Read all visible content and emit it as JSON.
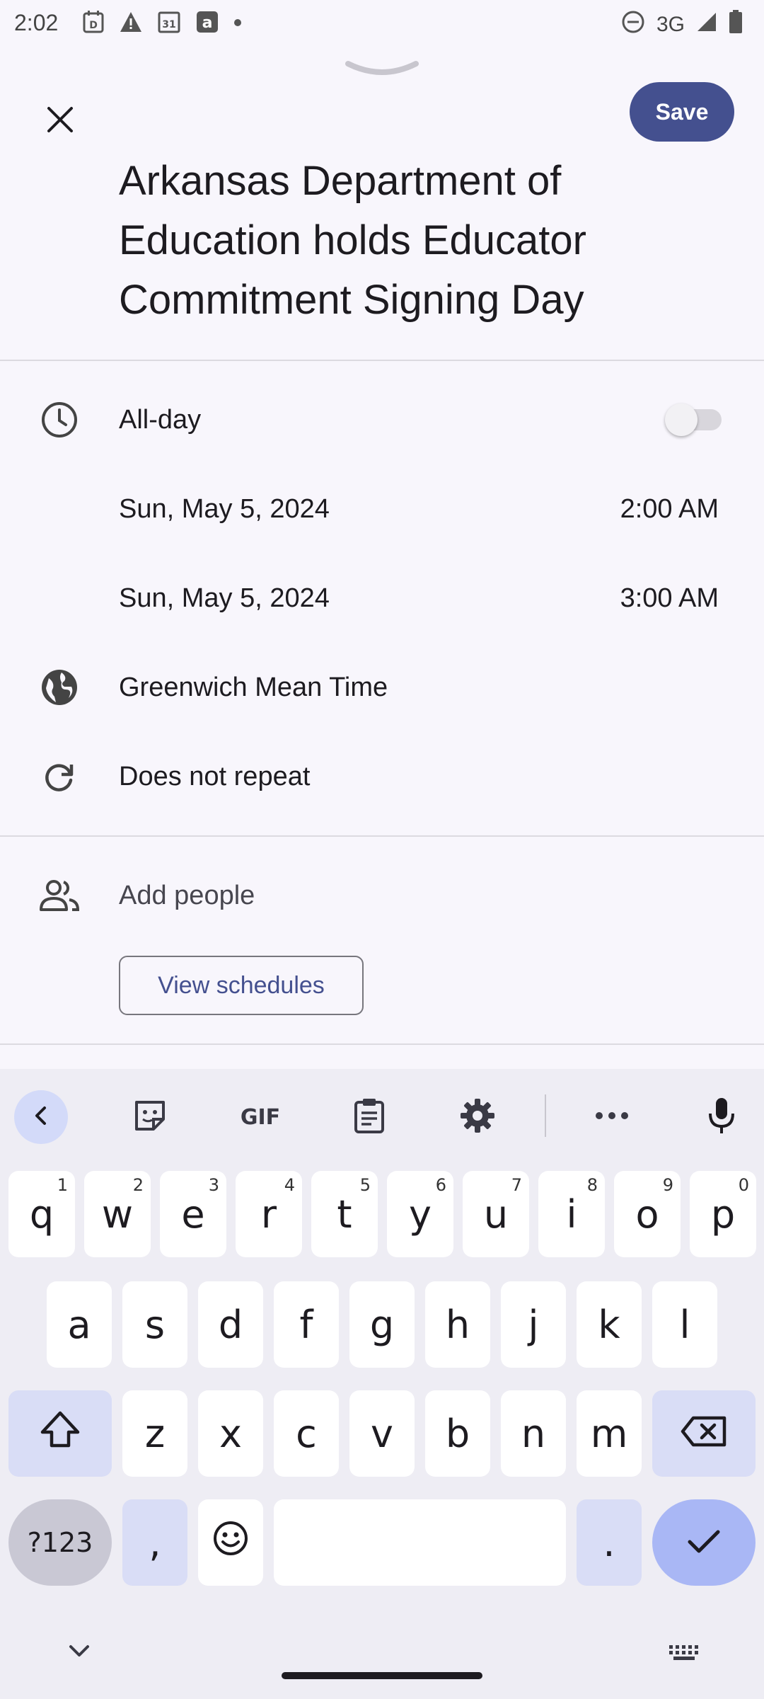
{
  "status_bar": {
    "time": "2:02",
    "network": "3G",
    "icons": [
      "calendar-d-icon",
      "warning-icon",
      "calendar-31-icon",
      "a-icon",
      "dot-icon",
      "dnd-icon",
      "signal-icon",
      "battery-icon"
    ]
  },
  "header": {
    "save_label": "Save",
    "title": "Arkansas Department of Education holds Educator Commitment Signing Day"
  },
  "event": {
    "allday_label": "All-day",
    "allday_on": false,
    "start_date": "Sun, May 5, 2024",
    "start_time": "2:00 AM",
    "end_date": "Sun, May 5, 2024",
    "end_time": "3:00 AM",
    "timezone": "Greenwich Mean Time",
    "repeat": "Does not repeat",
    "add_people": "Add people",
    "view_schedules": "View schedules"
  },
  "keyboard": {
    "toolbar": [
      "back-icon",
      "sticker-icon",
      "GIF",
      "clipboard-icon",
      "settings-icon",
      "more-icon",
      "mic-icon"
    ],
    "gif_label": "GIF",
    "row1": [
      {
        "k": "q",
        "n": "1"
      },
      {
        "k": "w",
        "n": "2"
      },
      {
        "k": "e",
        "n": "3"
      },
      {
        "k": "r",
        "n": "4"
      },
      {
        "k": "t",
        "n": "5"
      },
      {
        "k": "y",
        "n": "6"
      },
      {
        "k": "u",
        "n": "7"
      },
      {
        "k": "i",
        "n": "8"
      },
      {
        "k": "o",
        "n": "9"
      },
      {
        "k": "p",
        "n": "0"
      }
    ],
    "row2": [
      "a",
      "s",
      "d",
      "f",
      "g",
      "h",
      "j",
      "k",
      "l"
    ],
    "row3": [
      "z",
      "x",
      "c",
      "v",
      "b",
      "n",
      "m"
    ],
    "sym_label": "?123",
    "comma": ",",
    "period": "."
  },
  "colors": {
    "accent": "#44508f",
    "background": "#f8f6fc",
    "keyboard_bg": "#eeedf4",
    "enter_key": "#a9b7f5"
  }
}
